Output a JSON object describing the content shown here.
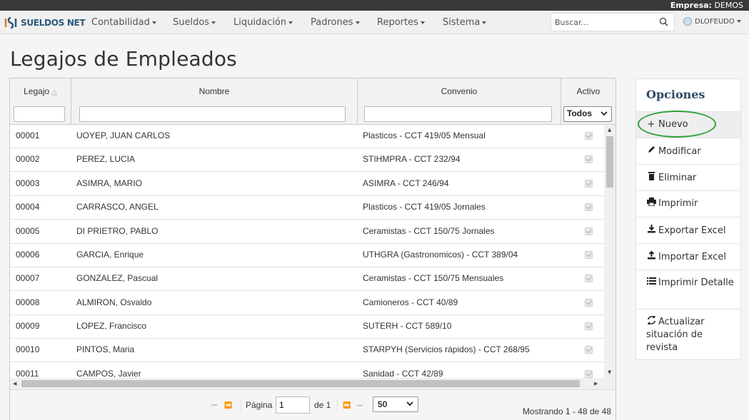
{
  "topbar": {
    "empresa_label": "Empresa:",
    "empresa_value": "DEMOS"
  },
  "navbar": {
    "brand": "SUELDOS NET",
    "menus": [
      "Contabilidad",
      "Sueldos",
      "Liquidación",
      "Padrones",
      "Reportes",
      "Sistema"
    ],
    "search_placeholder": "Buscar...",
    "user": "DLOFEUDO"
  },
  "page_title": "Legajos de Empleados",
  "grid": {
    "columns": [
      "Legajo",
      "Nombre",
      "Convenio",
      "Activo"
    ],
    "activo_filter": "Todos",
    "rows": [
      {
        "legajo": "00001",
        "nombre": "UOYEP, JUAN CARLOS",
        "convenio": "Plasticos - CCT 419/05 Mensual",
        "activo": true
      },
      {
        "legajo": "00002",
        "nombre": "PEREZ, LUCIA",
        "convenio": "STIHMPRA - CCT 232/94",
        "activo": true
      },
      {
        "legajo": "00003",
        "nombre": "ASIMRA, MARIO",
        "convenio": "ASIMRA - CCT 246/94",
        "activo": true
      },
      {
        "legajo": "00004",
        "nombre": "CARRASCO, ANGEL",
        "convenio": "Plasticos - CCT 419/05 Jornales",
        "activo": true
      },
      {
        "legajo": "00005",
        "nombre": "DI PRIETRO, PABLO",
        "convenio": "Ceramistas - CCT 150/75 Jornales",
        "activo": true
      },
      {
        "legajo": "00006",
        "nombre": "GARCIA, Enrique",
        "convenio": "UTHGRA (Gastronomicos) - CCT 389/04",
        "activo": true
      },
      {
        "legajo": "00007",
        "nombre": "GONZALEZ, Pascual",
        "convenio": "Ceramistas - CCT 150/75 Mensuales",
        "activo": true
      },
      {
        "legajo": "00008",
        "nombre": "ALMIRON, Osvaldo",
        "convenio": "Camioneros - CCT 40/89",
        "activo": true
      },
      {
        "legajo": "00009",
        "nombre": "LOPEZ, Francisco",
        "convenio": "SUTERH - CCT 589/10",
        "activo": true
      },
      {
        "legajo": "00010",
        "nombre": "PINTOS, Maria",
        "convenio": "STARPYH (Servicios rápidos) - CCT 268/95",
        "activo": true
      },
      {
        "legajo": "00011",
        "nombre": "CAMPOS, Javier",
        "convenio": "Sanidad - CCT 42/89",
        "activo": true
      }
    ],
    "pager": {
      "page_label": "Página",
      "page_value": "1",
      "of_label": "de 1",
      "page_size": "50",
      "showing": "Mostrando 1 - 48 de 48"
    }
  },
  "options": {
    "title": "Opciones",
    "items": [
      {
        "label": "Nuevo",
        "icon": "plus-icon"
      },
      {
        "label": "Modificar",
        "icon": "pencil-icon"
      },
      {
        "label": "Eliminar",
        "icon": "trash-icon"
      },
      {
        "label": "Imprimir",
        "icon": "print-icon"
      },
      {
        "label": "Exportar Excel",
        "icon": "download-icon"
      },
      {
        "label": "Importar Excel",
        "icon": "upload-icon"
      },
      {
        "label": "Imprimir Detalle",
        "icon": "list-icon"
      },
      {
        "label": "Actualizar situación de revista",
        "icon": "refresh-icon"
      }
    ]
  },
  "colors": {
    "brand": "#2a5a7a",
    "options_title": "#2c4a66",
    "highlight": "#2ea03a"
  }
}
